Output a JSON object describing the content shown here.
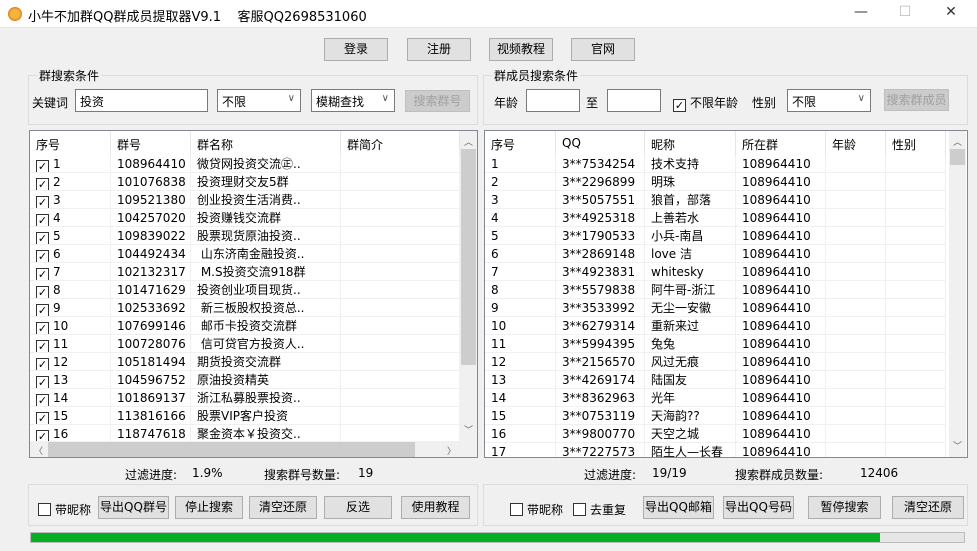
{
  "window": {
    "title": "小牛不加群QQ群成员提取器V9.1    客服QQ2698531060",
    "minimize": "—",
    "maximize": "☐",
    "close": "✕"
  },
  "top_buttons": [
    "登录",
    "注册",
    "视频教程",
    "官网"
  ],
  "group_search": {
    "label": "群搜索条件",
    "keyword_label": "关键词",
    "keyword_value": "投资",
    "filter_select": "不限",
    "mode_select": "模糊查找",
    "search_button": "搜索群号"
  },
  "member_search": {
    "label": "群成员搜索条件",
    "age_label": "年龄",
    "age_from": "",
    "to_label": "至",
    "age_to": "",
    "unlimited_age_label": "不限年龄",
    "unlimited_age_checked": true,
    "gender_label": "性别",
    "gender_select": "不限",
    "search_button": "搜索群成员"
  },
  "group_table": {
    "columns": [
      "序号",
      "群号",
      "群名称",
      "群简介"
    ],
    "rows": [
      [
        "1",
        "108964410",
        "微贷网投资交流㊣..",
        ""
      ],
      [
        "2",
        "101076838",
        "投资理财交友5群",
        ""
      ],
      [
        "3",
        "109521380",
        "创业投资生活消费..",
        ""
      ],
      [
        "4",
        "104257020",
        "投资赚钱交流群",
        ""
      ],
      [
        "5",
        "109839022",
        "股票现货原油投资..",
        ""
      ],
      [
        "6",
        "104492434",
        " 山东济南金融投资..",
        ""
      ],
      [
        "7",
        "102132317",
        " M.S投资交流918群",
        ""
      ],
      [
        "8",
        "101471629",
        "投资创业项目现货..",
        ""
      ],
      [
        "9",
        "102533692",
        " 新三板股权投资总..",
        ""
      ],
      [
        "10",
        "107699146",
        " 邮币卡投资交流群",
        ""
      ],
      [
        "11",
        "100728076",
        " 信可贷官方投资人..",
        ""
      ],
      [
        "12",
        "105181494",
        "期货投资交流群",
        ""
      ],
      [
        "13",
        "104596752",
        "原油投资精英",
        ""
      ],
      [
        "14",
        "101869137",
        "浙江私募股票投资..",
        ""
      ],
      [
        "15",
        "113816166",
        "股票VIP客户投资",
        ""
      ],
      [
        "16",
        "118747618",
        "聚金资本￥投资交..",
        ""
      ]
    ]
  },
  "member_table": {
    "columns": [
      "序号",
      "QQ",
      "昵称",
      "所在群",
      "年龄",
      "性别"
    ],
    "rows": [
      [
        "1",
        "3**7534254",
        "技术支持",
        "108964410",
        "",
        ""
      ],
      [
        "2",
        "3**2296899",
        "明珠",
        "108964410",
        "",
        ""
      ],
      [
        "3",
        "3**5057551",
        "狼首，部落",
        "108964410",
        "",
        ""
      ],
      [
        "4",
        "3**4925318",
        "上善若水",
        "108964410",
        "",
        ""
      ],
      [
        "5",
        "3**1790533",
        "小兵-南昌",
        "108964410",
        "",
        ""
      ],
      [
        "6",
        "3**2869148",
        "love 洁",
        "108964410",
        "",
        ""
      ],
      [
        "7",
        "3**4923831",
        "whitesky",
        "108964410",
        "",
        ""
      ],
      [
        "8",
        "3**5579838",
        "阿牛哥-浙江",
        "108964410",
        "",
        ""
      ],
      [
        "9",
        "3**3533992",
        "无尘一安徽",
        "108964410",
        "",
        ""
      ],
      [
        "10",
        "3**6279314",
        "重新来过",
        "108964410",
        "",
        ""
      ],
      [
        "11",
        "3**5994395",
        "兔兔",
        "108964410",
        "",
        ""
      ],
      [
        "12",
        "3**2156570",
        "风过无痕",
        "108964410",
        "",
        ""
      ],
      [
        "13",
        "3**4269174",
        "陆国友",
        "108964410",
        "",
        ""
      ],
      [
        "14",
        "3**8362963",
        "光年",
        "108964410",
        "",
        ""
      ],
      [
        "15",
        "3**0753119",
        "天海韵??",
        "108964410",
        "",
        ""
      ],
      [
        "16",
        "3**9800770",
        "天空之城",
        "108964410",
        "",
        ""
      ],
      [
        "17",
        "3**7227573",
        "陌生人—长春",
        "108964410",
        "",
        ""
      ]
    ]
  },
  "left_stats": {
    "progress_label": "过滤进度:",
    "progress_value": "1.9%",
    "count_label": "搜索群号数量:",
    "count_value": "19"
  },
  "right_stats": {
    "progress_label": "过滤进度:",
    "progress_value": "19/19",
    "count_label": "搜索群成员数量:",
    "count_value": "12406"
  },
  "left_actions": {
    "with_nickname": "带昵称",
    "buttons": [
      "导出QQ群号",
      "停止搜索",
      "清空还原",
      "反选",
      "使用教程"
    ]
  },
  "right_actions": {
    "with_nickname": "带昵称",
    "dedupe": "去重复",
    "buttons": [
      "导出QQ邮箱",
      "导出QQ号码",
      "暂停搜索",
      "清空还原"
    ]
  },
  "progress_percent": 91,
  "colors": {
    "progress": "#06b025",
    "check": "✓"
  }
}
